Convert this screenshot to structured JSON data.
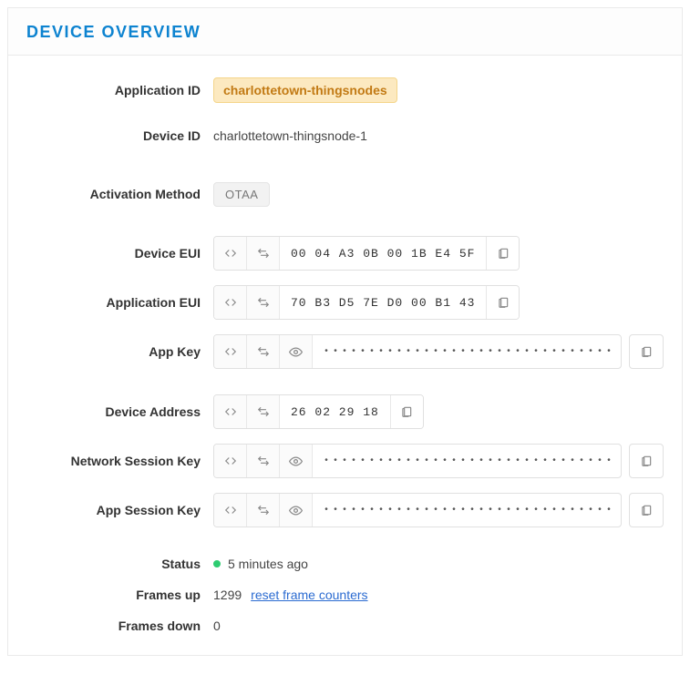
{
  "header": {
    "title": "DEVICE OVERVIEW"
  },
  "fields": {
    "application_id": {
      "label": "Application ID",
      "value": "charlottetown-thingsnodes"
    },
    "device_id": {
      "label": "Device ID",
      "value": "charlottetown-thingsnode-1"
    },
    "activation_method": {
      "label": "Activation Method",
      "value": "OTAA"
    },
    "device_eui": {
      "label": "Device EUI",
      "value": "00 04 A3 0B 00 1B E4 5F"
    },
    "application_eui": {
      "label": "Application EUI",
      "value": "70 B3 D5 7E D0 00 B1 43"
    },
    "app_key": {
      "label": "App Key",
      "value": "••••••••••••••••••••••••••••••••"
    },
    "device_address": {
      "label": "Device Address",
      "value": "26 02 29 18"
    },
    "network_session_key": {
      "label": "Network Session Key",
      "value": "••••••••••••••••••••••••••••••••"
    },
    "app_session_key": {
      "label": "App Session Key",
      "value": "••••••••••••••••••••••••••••••••"
    },
    "status": {
      "label": "Status",
      "value": "5 minutes ago"
    },
    "frames_up": {
      "label": "Frames up",
      "value": "1299",
      "link": "reset frame counters"
    },
    "frames_down": {
      "label": "Frames down",
      "value": "0"
    }
  }
}
